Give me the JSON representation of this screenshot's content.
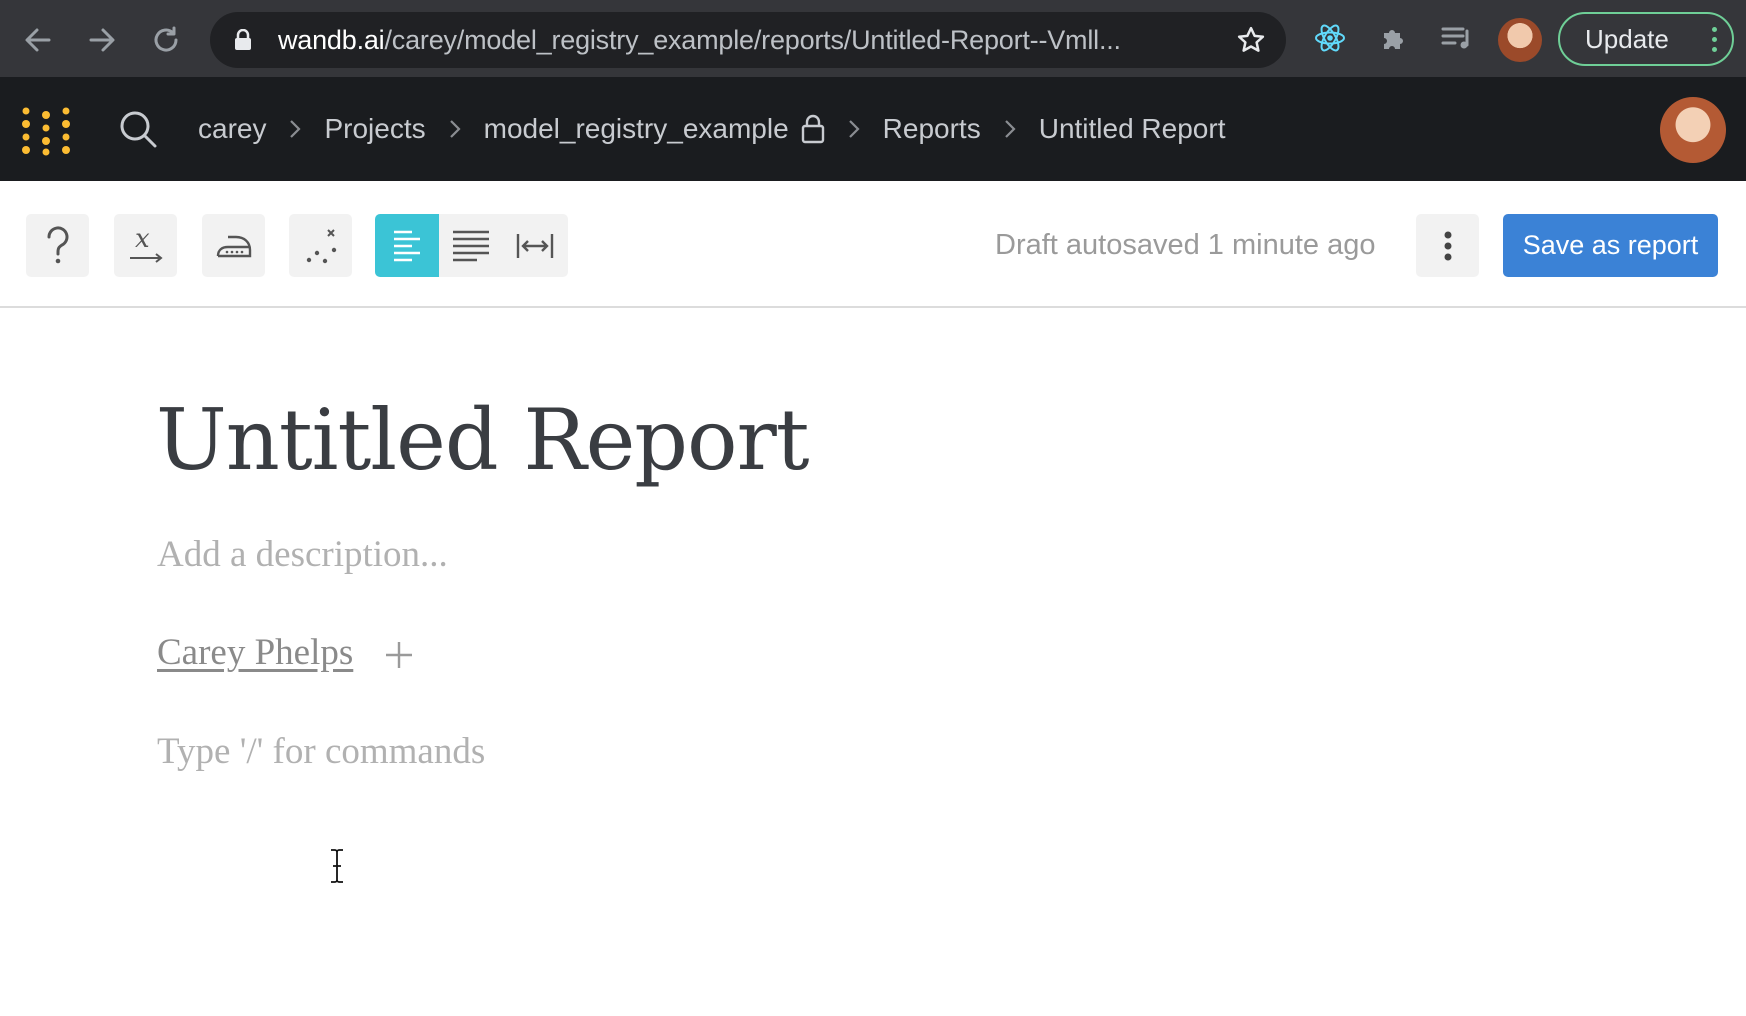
{
  "browser": {
    "url_host": "wandb.ai",
    "url_path": "/carey/model_registry_example/reports/Untitled-Report--Vmll...",
    "update_label": "Update"
  },
  "nav": {
    "breadcrumbs": [
      "carey",
      "Projects",
      "model_registry_example",
      "Reports",
      "Untitled Report"
    ]
  },
  "toolbar": {
    "autosave_status": "Draft autosaved 1 minute ago",
    "save_label": "Save as report",
    "active_alignment": "align-left",
    "active_color": "#3bc4d6",
    "save_color": "#3b82d6"
  },
  "document": {
    "title": "Untitled Report",
    "description_placeholder": "Add a description...",
    "author": "Carey Phelps",
    "command_placeholder": "Type '/' for commands"
  }
}
